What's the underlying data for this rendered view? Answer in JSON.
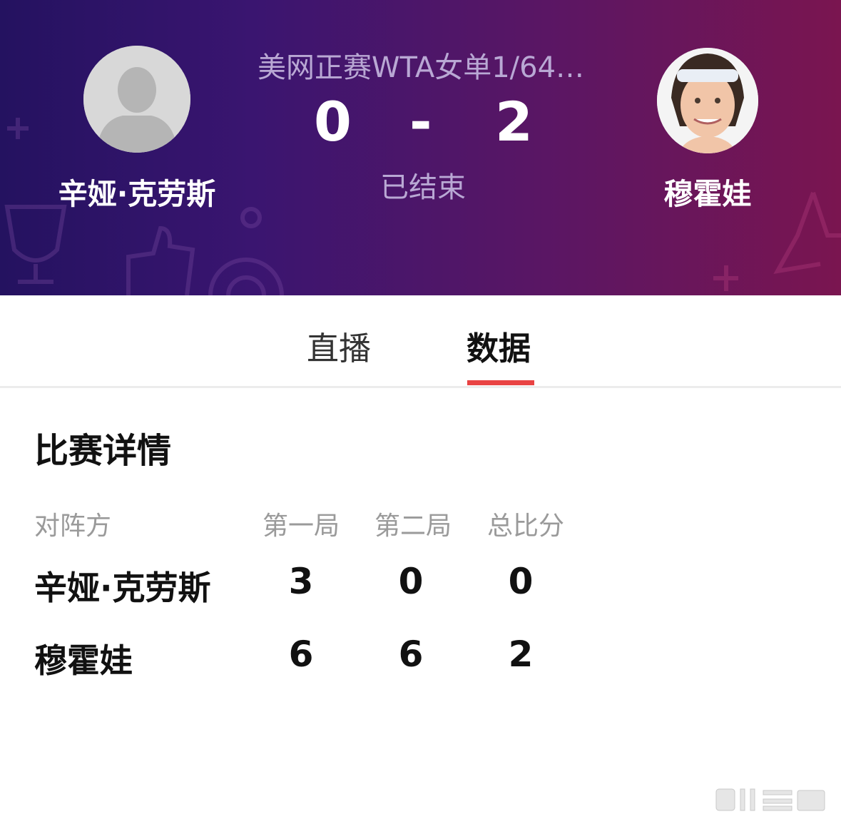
{
  "header": {
    "event_title": "美网正赛WTA女单1/64…",
    "home_score": "0",
    "score_separator": "-",
    "away_score": "2",
    "status": "已结束",
    "home_player": "辛娅·克劳斯",
    "away_player": "穆霍娃",
    "colors": {
      "gradient_start": "#241260",
      "gradient_end": "#7a1550"
    }
  },
  "tabs": [
    {
      "label": "直播",
      "active": false
    },
    {
      "label": "数据",
      "active": true
    }
  ],
  "accent_color": "#e94343",
  "details": {
    "title": "比赛详情",
    "columns": [
      "对阵方",
      "第一局",
      "第二局",
      "总比分"
    ],
    "rows": [
      {
        "name": "辛娅·克劳斯",
        "values": [
          "3",
          "0",
          "0"
        ]
      },
      {
        "name": "穆霍娃",
        "values": [
          "6",
          "6",
          "2"
        ]
      }
    ]
  },
  "icons": [
    "default-avatar-icon",
    "player-photo-icon",
    "trophy-icon",
    "thumbs-up-icon",
    "target-icon",
    "star-icon",
    "watermark-icon"
  ]
}
